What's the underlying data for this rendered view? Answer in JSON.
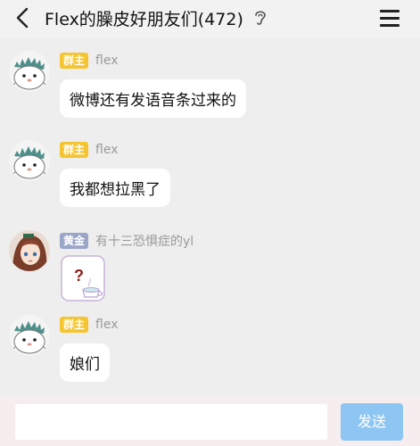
{
  "header": {
    "title": "Flex的臊皮好朋友们(472)",
    "icons": [
      "back-icon",
      "ear-icon",
      "menu-icon"
    ]
  },
  "messages": [
    {
      "badge": "群主",
      "badge_color": "#f5c431",
      "sender": "flex",
      "text": "微博还有发语音条过来的",
      "avatar": "fluffy-character-avatar"
    },
    {
      "badge": "群主",
      "badge_color": "#f5c431",
      "sender": "flex",
      "text": "我都想拉黑了",
      "avatar": "fluffy-character-avatar"
    },
    {
      "badge": "黄金",
      "badge_color": "#9aa6c8",
      "sender": "有十三恐惧症的yl",
      "sticker": "question-mark-sticker",
      "avatar": "anime-girl-avatar"
    },
    {
      "badge": "群主",
      "badge_color": "#f5c431",
      "sender": "flex",
      "text": "娘们",
      "avatar": "fluffy-character-avatar"
    }
  ],
  "input": {
    "value": "",
    "send_label": "发送"
  },
  "colors": {
    "background": "#eeeeee",
    "bubble": "#ffffff",
    "send_button": "#8ec6f3"
  }
}
